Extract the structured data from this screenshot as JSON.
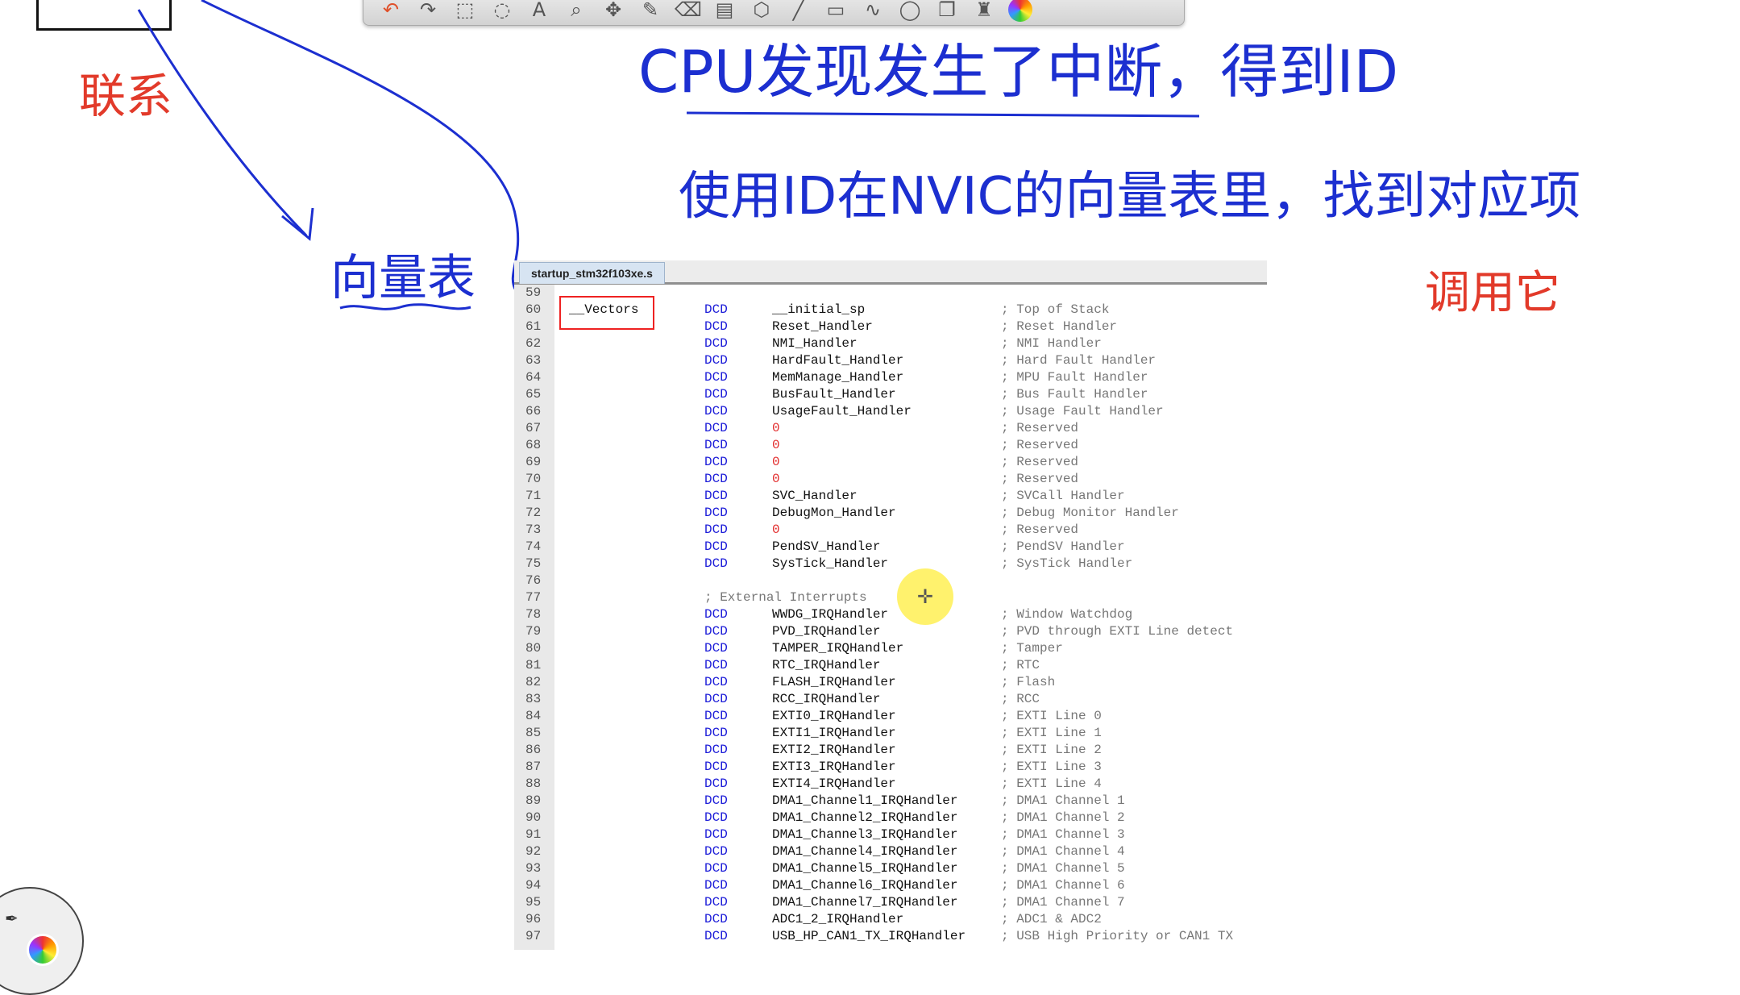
{
  "toolbar": {
    "icons": [
      "undo-icon",
      "redo-icon",
      "rectangle-select-icon",
      "lasso-icon",
      "text-icon",
      "zoom-icon",
      "move-icon",
      "pen-icon",
      "eraser-icon",
      "highlighter-icon",
      "shapes-icon",
      "line-icon",
      "rect-icon",
      "curve-icon",
      "ellipse-icon",
      "copy-icon",
      "stamp-icon",
      "color-palette-icon"
    ]
  },
  "annotations": {
    "link_label": "联系",
    "vector_table_label": "向量表",
    "title_line": "CPU发现发生了中断，得到ID",
    "use_line": "使用ID在NVIC的向量表里，找到对应项",
    "call_it": "调用它",
    "ink_blue": "#1c2fd0",
    "ink_red": "#e23a2a"
  },
  "editor": {
    "tab_label": "startup_stm32f103xe.s",
    "lines": [
      {
        "n": "59",
        "label": "",
        "kw": "",
        "op": "",
        "cm": ""
      },
      {
        "n": "60",
        "label": "__Vectors",
        "kw": "DCD",
        "op": "__initial_sp",
        "cm": "; Top of Stack"
      },
      {
        "n": "61",
        "label": "",
        "kw": "DCD",
        "op": "Reset_Handler",
        "cm": "; Reset Handler"
      },
      {
        "n": "62",
        "label": "",
        "kw": "DCD",
        "op": "NMI_Handler",
        "cm": "; NMI Handler"
      },
      {
        "n": "63",
        "label": "",
        "kw": "DCD",
        "op": "HardFault_Handler",
        "cm": "; Hard Fault Handler"
      },
      {
        "n": "64",
        "label": "",
        "kw": "DCD",
        "op": "MemManage_Handler",
        "cm": "; MPU Fault Handler"
      },
      {
        "n": "65",
        "label": "",
        "kw": "DCD",
        "op": "BusFault_Handler",
        "cm": "; Bus Fault Handler"
      },
      {
        "n": "66",
        "label": "",
        "kw": "DCD",
        "op": "UsageFault_Handler",
        "cm": "; Usage Fault Handler"
      },
      {
        "n": "67",
        "label": "",
        "kw": "DCD",
        "op": "0",
        "cm": "; Reserved"
      },
      {
        "n": "68",
        "label": "",
        "kw": "DCD",
        "op": "0",
        "cm": "; Reserved"
      },
      {
        "n": "69",
        "label": "",
        "kw": "DCD",
        "op": "0",
        "cm": "; Reserved"
      },
      {
        "n": "70",
        "label": "",
        "kw": "DCD",
        "op": "0",
        "cm": "; Reserved"
      },
      {
        "n": "71",
        "label": "",
        "kw": "DCD",
        "op": "SVC_Handler",
        "cm": "; SVCall Handler"
      },
      {
        "n": "72",
        "label": "",
        "kw": "DCD",
        "op": "DebugMon_Handler",
        "cm": "; Debug Monitor Handler"
      },
      {
        "n": "73",
        "label": "",
        "kw": "DCD",
        "op": "0",
        "cm": "; Reserved"
      },
      {
        "n": "74",
        "label": "",
        "kw": "DCD",
        "op": "PendSV_Handler",
        "cm": "; PendSV Handler"
      },
      {
        "n": "75",
        "label": "",
        "kw": "DCD",
        "op": "SysTick_Handler",
        "cm": "; SysTick Handler"
      },
      {
        "n": "76",
        "label": "",
        "kw": "",
        "op": "",
        "cm": ""
      },
      {
        "n": "77",
        "label": "",
        "kw": "",
        "op": "",
        "cm": "; External Interrupts"
      },
      {
        "n": "78",
        "label": "",
        "kw": "DCD",
        "op": "WWDG_IRQHandler",
        "cm": "; Window Watchdog"
      },
      {
        "n": "79",
        "label": "",
        "kw": "DCD",
        "op": "PVD_IRQHandler",
        "cm": "; PVD through EXTI Line detect"
      },
      {
        "n": "80",
        "label": "",
        "kw": "DCD",
        "op": "TAMPER_IRQHandler",
        "cm": "; Tamper"
      },
      {
        "n": "81",
        "label": "",
        "kw": "DCD",
        "op": "RTC_IRQHandler",
        "cm": "; RTC"
      },
      {
        "n": "82",
        "label": "",
        "kw": "DCD",
        "op": "FLASH_IRQHandler",
        "cm": "; Flash"
      },
      {
        "n": "83",
        "label": "",
        "kw": "DCD",
        "op": "RCC_IRQHandler",
        "cm": "; RCC"
      },
      {
        "n": "84",
        "label": "",
        "kw": "DCD",
        "op": "EXTI0_IRQHandler",
        "cm": "; EXTI Line 0"
      },
      {
        "n": "85",
        "label": "",
        "kw": "DCD",
        "op": "EXTI1_IRQHandler",
        "cm": "; EXTI Line 1"
      },
      {
        "n": "86",
        "label": "",
        "kw": "DCD",
        "op": "EXTI2_IRQHandler",
        "cm": "; EXTI Line 2"
      },
      {
        "n": "87",
        "label": "",
        "kw": "DCD",
        "op": "EXTI3_IRQHandler",
        "cm": "; EXTI Line 3"
      },
      {
        "n": "88",
        "label": "",
        "kw": "DCD",
        "op": "EXTI4_IRQHandler",
        "cm": "; EXTI Line 4"
      },
      {
        "n": "89",
        "label": "",
        "kw": "DCD",
        "op": "DMA1_Channel1_IRQHandler",
        "cm": "; DMA1 Channel 1"
      },
      {
        "n": "90",
        "label": "",
        "kw": "DCD",
        "op": "DMA1_Channel2_IRQHandler",
        "cm": "; DMA1 Channel 2"
      },
      {
        "n": "91",
        "label": "",
        "kw": "DCD",
        "op": "DMA1_Channel3_IRQHandler",
        "cm": "; DMA1 Channel 3"
      },
      {
        "n": "92",
        "label": "",
        "kw": "DCD",
        "op": "DMA1_Channel4_IRQHandler",
        "cm": "; DMA1 Channel 4"
      },
      {
        "n": "93",
        "label": "",
        "kw": "DCD",
        "op": "DMA1_Channel5_IRQHandler",
        "cm": "; DMA1 Channel 5"
      },
      {
        "n": "94",
        "label": "",
        "kw": "DCD",
        "op": "DMA1_Channel6_IRQHandler",
        "cm": "; DMA1 Channel 6"
      },
      {
        "n": "95",
        "label": "",
        "kw": "DCD",
        "op": "DMA1_Channel7_IRQHandler",
        "cm": "; DMA1 Channel 7"
      },
      {
        "n": "96",
        "label": "",
        "kw": "DCD",
        "op": "ADC1_2_IRQHandler",
        "cm": "; ADC1 & ADC2"
      },
      {
        "n": "97",
        "label": "",
        "kw": "DCD",
        "op": "USB_HP_CAN1_TX_IRQHandler",
        "cm": "; USB High Priority or CAN1 TX"
      }
    ]
  }
}
